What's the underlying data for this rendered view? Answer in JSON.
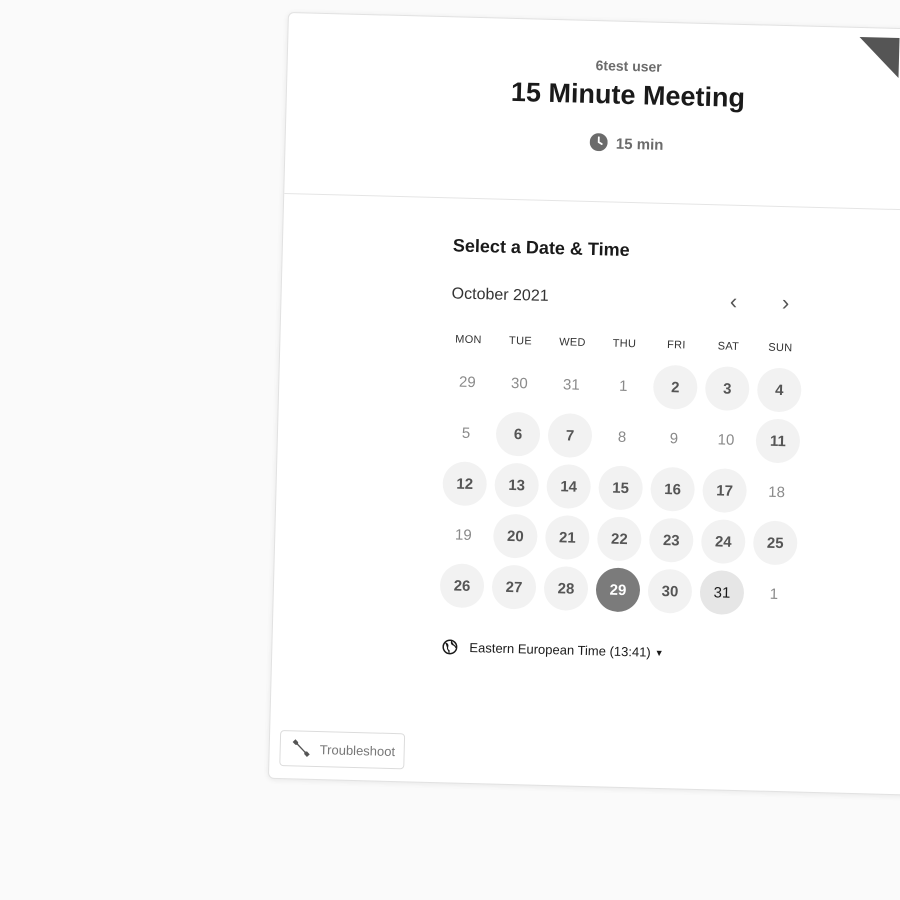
{
  "header": {
    "owner": "6test user",
    "event_title": "15 Minute Meeting",
    "duration": "15 min",
    "clock_icon": "clock-icon"
  },
  "calendar": {
    "section_title": "Select a Date & Time",
    "month_label": "October 2021",
    "prev_symbol": "‹",
    "next_symbol": "›",
    "weekdays": [
      "MON",
      "TUE",
      "WED",
      "THU",
      "FRI",
      "SAT",
      "SUN"
    ],
    "days": [
      {
        "label": "29",
        "state": "unavailable"
      },
      {
        "label": "30",
        "state": "unavailable"
      },
      {
        "label": "31",
        "state": "unavailable"
      },
      {
        "label": "1",
        "state": "unavailable"
      },
      {
        "label": "2",
        "state": "available"
      },
      {
        "label": "3",
        "state": "available"
      },
      {
        "label": "4",
        "state": "available"
      },
      {
        "label": "5",
        "state": "unavailable"
      },
      {
        "label": "6",
        "state": "available"
      },
      {
        "label": "7",
        "state": "available"
      },
      {
        "label": "8",
        "state": "unavailable"
      },
      {
        "label": "9",
        "state": "unavailable"
      },
      {
        "label": "10",
        "state": "unavailable"
      },
      {
        "label": "11",
        "state": "available"
      },
      {
        "label": "12",
        "state": "available"
      },
      {
        "label": "13",
        "state": "available"
      },
      {
        "label": "14",
        "state": "available"
      },
      {
        "label": "15",
        "state": "available"
      },
      {
        "label": "16",
        "state": "available"
      },
      {
        "label": "17",
        "state": "available"
      },
      {
        "label": "18",
        "state": "unavailable"
      },
      {
        "label": "19",
        "state": "unavailable"
      },
      {
        "label": "20",
        "state": "available"
      },
      {
        "label": "21",
        "state": "available"
      },
      {
        "label": "22",
        "state": "available"
      },
      {
        "label": "23",
        "state": "available"
      },
      {
        "label": "24",
        "state": "available"
      },
      {
        "label": "25",
        "state": "available"
      },
      {
        "label": "26",
        "state": "available"
      },
      {
        "label": "27",
        "state": "available"
      },
      {
        "label": "28",
        "state": "available"
      },
      {
        "label": "29",
        "state": "selected"
      },
      {
        "label": "30",
        "state": "available"
      },
      {
        "label": "31",
        "state": "today"
      },
      {
        "label": "1",
        "state": "unavailable"
      }
    ]
  },
  "timezone": {
    "label": "Eastern European Time (13:41)",
    "caret": "▼",
    "icon": "globe-icon"
  },
  "troubleshoot": {
    "label": "Troubleshoot",
    "icon": "wrench-icon"
  },
  "colors": {
    "selected_day": "#7b7b7b",
    "available_day": "#f2f2f2",
    "corner_ribbon": "#555555"
  }
}
